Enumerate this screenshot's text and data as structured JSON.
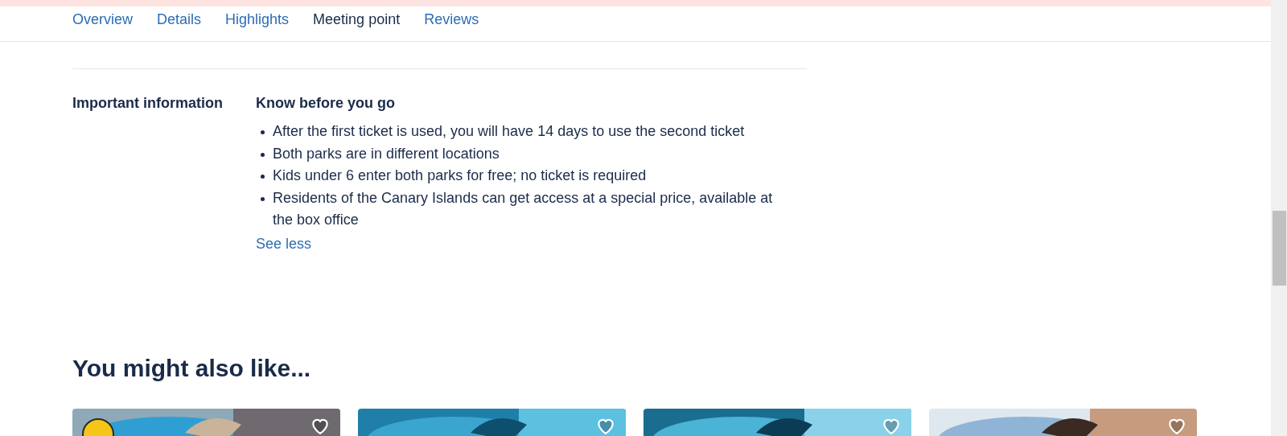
{
  "tabs": [
    {
      "label": "Overview",
      "selected": false
    },
    {
      "label": "Details",
      "selected": false
    },
    {
      "label": "Highlights",
      "selected": false
    },
    {
      "label": "Meeting point",
      "selected": true
    },
    {
      "label": "Reviews",
      "selected": false
    }
  ],
  "important_information": {
    "label": "Important information",
    "heading": "Know before you go",
    "items": [
      "After the first ticket is used, you will have 14 days to use the second ticket",
      "Both parks are in different locations",
      "Kids under 6 enter both parks for free; no ticket is required",
      "Residents of the Canary Islands can get access at a special price, available at the box office"
    ],
    "toggle": "See less"
  },
  "recommendations": {
    "title": "You might also like...",
    "cards": [
      {
        "kind": "picture",
        "badge": true
      },
      {
        "kind": "picture",
        "badge": false
      },
      {
        "kind": "picture",
        "badge": false
      },
      {
        "kind": "picture",
        "badge": false
      }
    ]
  }
}
